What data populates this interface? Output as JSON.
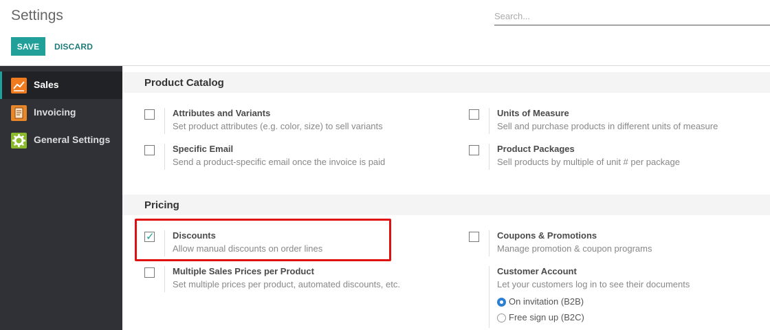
{
  "header": {
    "title": "Settings",
    "search_placeholder": "Search...",
    "save_label": "SAVE",
    "discard_label": "DISCARD"
  },
  "sidebar": {
    "items": [
      {
        "label": "Sales",
        "icon": "sales-chart-icon",
        "active": true
      },
      {
        "label": "Invoicing",
        "icon": "invoicing-icon",
        "active": false
      },
      {
        "label": "General Settings",
        "icon": "gear-icon",
        "active": false
      }
    ]
  },
  "sections": {
    "product_catalog": {
      "title": "Product Catalog",
      "settings": [
        {
          "label": "Attributes and Variants",
          "help": "Set product attributes (e.g. color, size) to sell variants",
          "checked": false
        },
        {
          "label": "Units of Measure",
          "help": "Sell and purchase products in different units of measure",
          "checked": false
        },
        {
          "label": "Specific Email",
          "help": "Send a product-specific email once the invoice is paid",
          "checked": false
        },
        {
          "label": "Product Packages",
          "help": "Sell products by multiple of unit # per package",
          "checked": false
        }
      ]
    },
    "pricing": {
      "title": "Pricing",
      "settings": [
        {
          "label": "Discounts",
          "help": "Allow manual discounts on order lines",
          "checked": true
        },
        {
          "label": "Coupons & Promotions",
          "help": "Manage promotion & coupon programs",
          "checked": false
        },
        {
          "label": "Multiple Sales Prices per Product",
          "help": "Set multiple prices per product, automated discounts, etc.",
          "checked": false
        }
      ],
      "customer_account": {
        "label": "Customer Account",
        "help": "Let your customers log in to see their documents",
        "options": [
          {
            "label": "On invitation (B2B)",
            "selected": true
          },
          {
            "label": "Free sign up (B2C)",
            "selected": false
          }
        ]
      }
    }
  },
  "colors": {
    "accent": "#21a09a",
    "sidebar_bg": "#2f3136",
    "highlight": "#e01010",
    "radio_selected": "#2e7fd1"
  }
}
